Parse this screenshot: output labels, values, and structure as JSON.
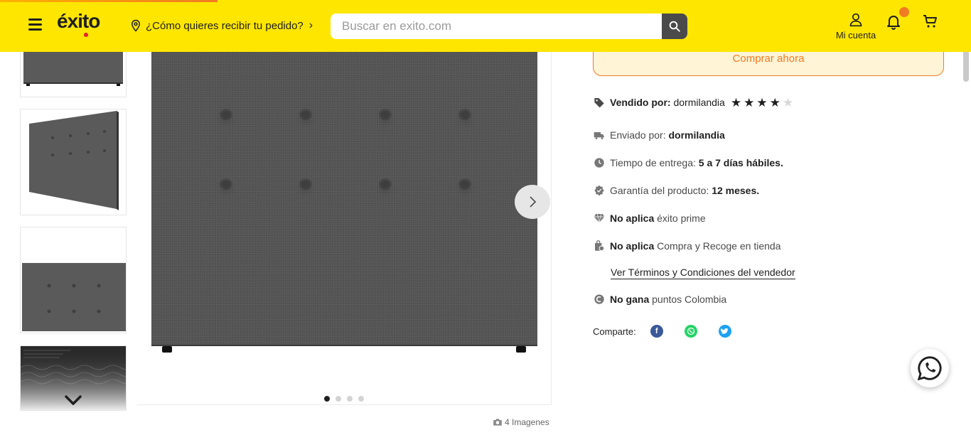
{
  "header": {
    "logo_text": "éxito",
    "location_text": "¿Cómo quieres recibir tu pedido?",
    "search_placeholder": "Buscar en exito.com",
    "account_label": "Mi cuenta"
  },
  "gallery": {
    "image_count_label": "4 Imagenes",
    "dots": 4,
    "active_dot": 0
  },
  "product": {
    "buy_now_label": "Comprar ahora",
    "sold_by_label": "Vendido por:",
    "sold_by_value": "dormilandia",
    "rating_stars": 4,
    "rating_max": 5,
    "shipped_by_label": "Enviado por:",
    "shipped_by_value": "dormilandia",
    "delivery_label": "Tiempo de entrega:",
    "delivery_value": "5 a 7 días hábiles.",
    "warranty_label": "Garantía del producto:",
    "warranty_value": "12 meses.",
    "prime_status": "No aplica",
    "prime_label": "éxito prime",
    "pickup_status": "No aplica",
    "pickup_label": "Compra y Recoge en tienda",
    "terms_link": "Ver Términos y Condiciones del vendedor",
    "points_status": "No gana",
    "points_label": "puntos Colombia",
    "share_label": "Comparte:"
  },
  "colors": {
    "brand_yellow": "#ffe600",
    "accent_orange": "#f07b23",
    "facebook": "#3b5998",
    "whatsapp": "#25d366",
    "twitter": "#1da1f2"
  }
}
